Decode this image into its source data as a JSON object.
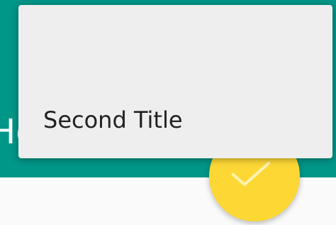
{
  "app_bar": {
    "title": "He",
    "color": "#009688"
  },
  "popup": {
    "title": "Second Title",
    "background": "#EEEEEE"
  },
  "fab": {
    "icon": "check-icon",
    "color": "#FDD835"
  }
}
